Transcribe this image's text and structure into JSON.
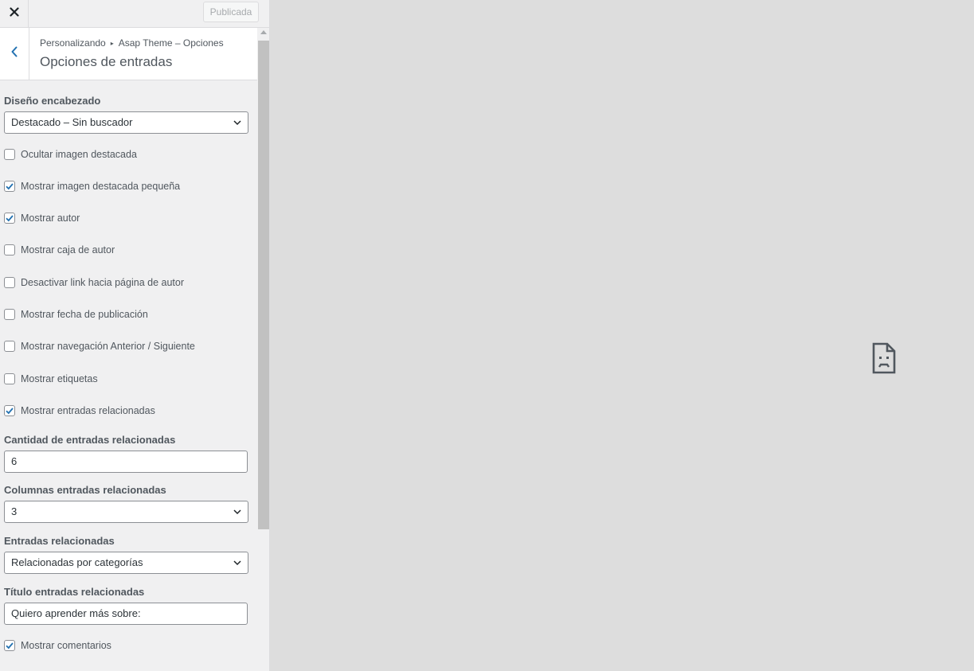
{
  "topbar": {
    "close_icon": "close-icon",
    "publish_label": "Publicada"
  },
  "header": {
    "back_icon": "chevron-left-icon",
    "breadcrumb_root": "Personalizando",
    "breadcrumb_separator": "▸",
    "breadcrumb_section": "Asap Theme – Opciones",
    "title": "Opciones de entradas"
  },
  "controls": {
    "header_design": {
      "label": "Diseño encabezado",
      "value": "Destacado – Sin buscador"
    },
    "checkboxes": [
      {
        "label": "Ocultar imagen destacada",
        "checked": false
      },
      {
        "label": "Mostrar imagen destacada pequeña",
        "checked": true
      },
      {
        "label": "Mostrar autor",
        "checked": true
      },
      {
        "label": "Mostrar caja de autor",
        "checked": false
      },
      {
        "label": "Desactivar link hacia página de autor",
        "checked": false
      },
      {
        "label": "Mostrar fecha de publicación",
        "checked": false
      },
      {
        "label": "Mostrar navegación Anterior / Siguiente",
        "checked": false
      },
      {
        "label": "Mostrar etiquetas",
        "checked": false
      },
      {
        "label": "Mostrar entradas relacionadas",
        "checked": true
      }
    ],
    "related_count": {
      "label": "Cantidad de entradas relacionadas",
      "value": "6"
    },
    "related_columns": {
      "label": "Columnas entradas relacionadas",
      "value": "3"
    },
    "related_posts": {
      "label": "Entradas relacionadas",
      "value": "Relacionadas por categorías"
    },
    "related_title": {
      "label": "Título entradas relacionadas",
      "value": "Quiero aprender más sobre:"
    },
    "show_comments": {
      "label": "Mostrar comentarios",
      "checked": true
    }
  },
  "preview": {
    "icon": "sad-page-icon"
  },
  "colors": {
    "accent": "#2271b1",
    "sidebar_bg": "#f0f0f1",
    "preview_bg": "#dddddd"
  }
}
